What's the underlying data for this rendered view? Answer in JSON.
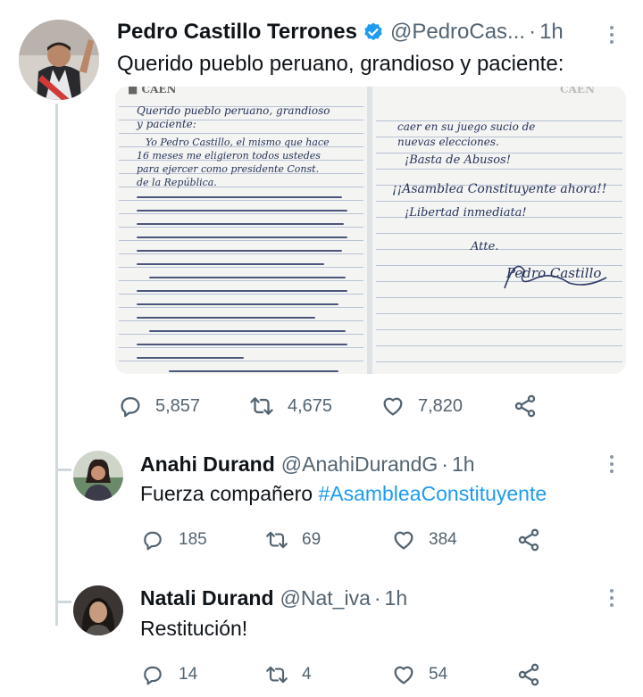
{
  "main_tweet": {
    "name": "Pedro Castillo Terrones",
    "handle": "@PedroCas...",
    "time": "1h",
    "text": "Querido pueblo peruano, grandioso y paciente:",
    "letter": {
      "left_page_lines": [
        "Querido pueblo peruano, grandioso",
        "y paciente:",
        "Yo Pedro Castillo, el mismo que hace",
        "16 meses me eligieron todos ustedes",
        "para ejercer como presidente Const.",
        "de la República."
      ],
      "right_page_lines": [
        "caer en su juego sucio de",
        "nuevas elecciones.",
        "¡Basta de Abusos!",
        "¡¡Asamblea Constituyente ahora!!",
        "¡Libertad inmediata!",
        "Atte.",
        "Pedro Castillo"
      ]
    },
    "stats": {
      "replies": "5,857",
      "retweets": "4,675",
      "likes": "7,820"
    }
  },
  "replies": [
    {
      "name": "Anahi Durand",
      "handle": "@AnahiDurandG",
      "time": "1h",
      "text": "Fuerza compañero ",
      "hashtag": "#AsambleaConstituyente",
      "stats": {
        "replies": "185",
        "retweets": "69",
        "likes": "384"
      }
    },
    {
      "name": "Natali Durand",
      "handle": "@Nat_iva",
      "time": "1h",
      "text": "Restitución!",
      "stats": {
        "replies": "14",
        "retweets": "4",
        "likes": "54"
      }
    }
  ],
  "colors": {
    "accent": "#1d9bf0",
    "muted": "#536471",
    "thread": "#cfd9de",
    "verified": "#1d9bf0"
  }
}
